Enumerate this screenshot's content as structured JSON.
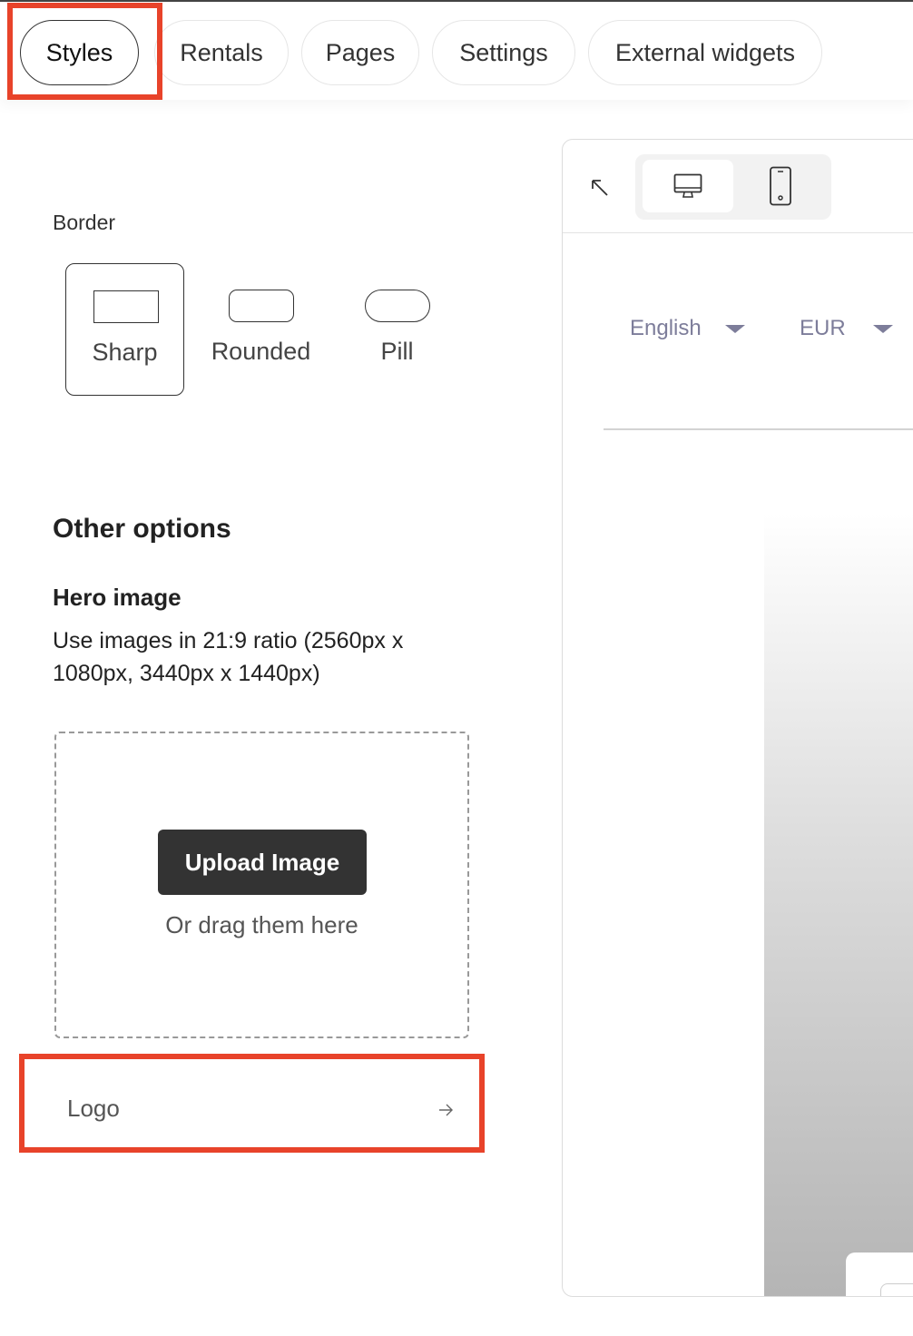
{
  "tabs": [
    {
      "label": "Styles",
      "active": true
    },
    {
      "label": "Rentals",
      "active": false
    },
    {
      "label": "Pages",
      "active": false
    },
    {
      "label": "Settings",
      "active": false
    },
    {
      "label": "External widgets",
      "active": false
    }
  ],
  "border": {
    "label": "Border",
    "options": [
      {
        "label": "Sharp",
        "selected": true
      },
      {
        "label": "Rounded",
        "selected": false
      },
      {
        "label": "Pill",
        "selected": false
      }
    ]
  },
  "other_options": {
    "heading": "Other options",
    "hero_image": {
      "title": "Hero image",
      "description": "Use images in 21:9 ratio (2560px x 1080px, 3440px x 1440px)",
      "upload_button": "Upload Image",
      "drag_text": "Or drag them here"
    },
    "logo_label": "Logo"
  },
  "preview": {
    "language": "English",
    "currency": "EUR",
    "active_device": "desktop"
  },
  "colors": {
    "highlight": "#e8432a",
    "primary_button": "#333333",
    "muted_text": "#7d7d9a"
  }
}
